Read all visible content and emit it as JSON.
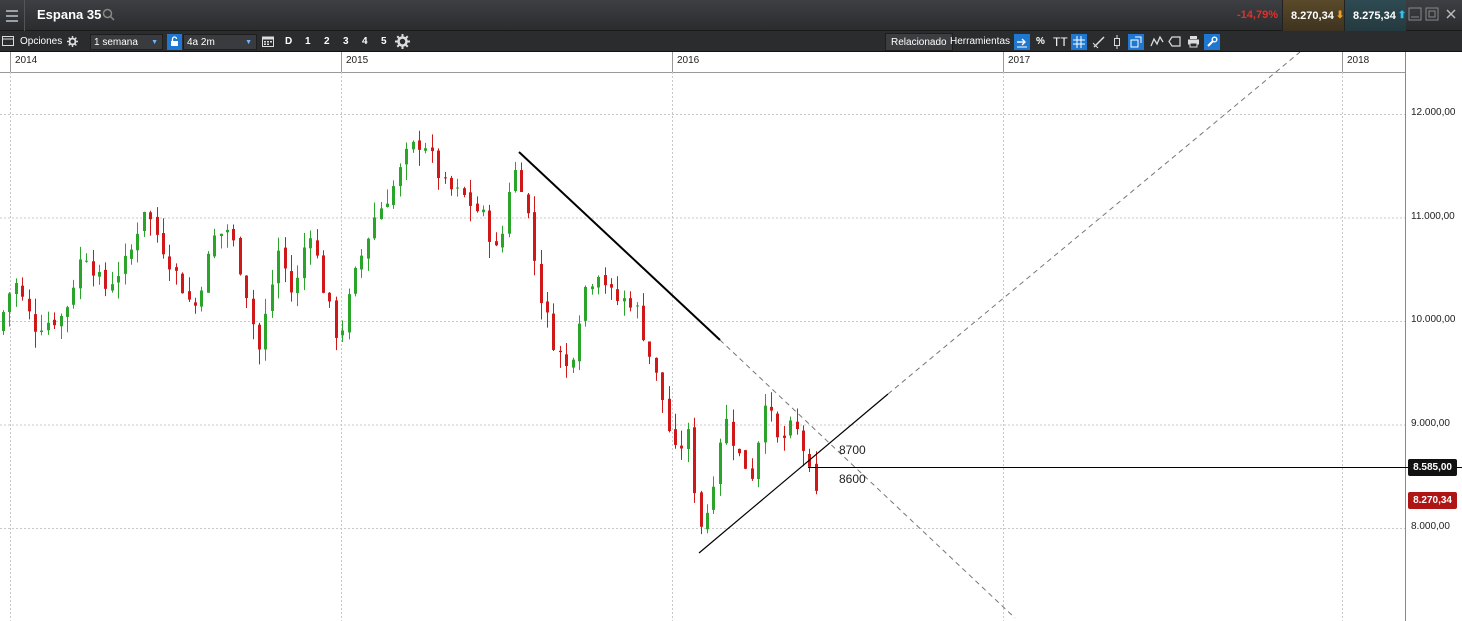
{
  "titlebar": {
    "instrument": "Espana 35",
    "change_pct": "-14,79%",
    "sell_price": "8.270,34",
    "buy_price": "8.275,34"
  },
  "toolbar": {
    "options_label": "Opciones",
    "interval": "1 semana",
    "range": "4a 2m",
    "period_buttons": [
      "D",
      "1",
      "2",
      "3",
      "4",
      "5"
    ],
    "related_label": "Relacionado",
    "tools_label": "Herramientas",
    "percent_label": "%",
    "text_tool_label": "TT"
  },
  "chart": {
    "x_axis_labels": [
      "2014",
      "2015",
      "2016",
      "2017",
      "2018"
    ],
    "y_axis_labels": [
      "12.000,00",
      "11.000,00",
      "10.000,00",
      "9.000,00",
      "8.000,00"
    ],
    "horizontal_line_label": "8.585,00",
    "current_price_label": "8.270,34",
    "annotations": [
      "8700",
      "8600"
    ],
    "colors": {
      "up": "#2aa52a",
      "down": "#d01818",
      "grid": "#c8c8c8"
    }
  }
}
